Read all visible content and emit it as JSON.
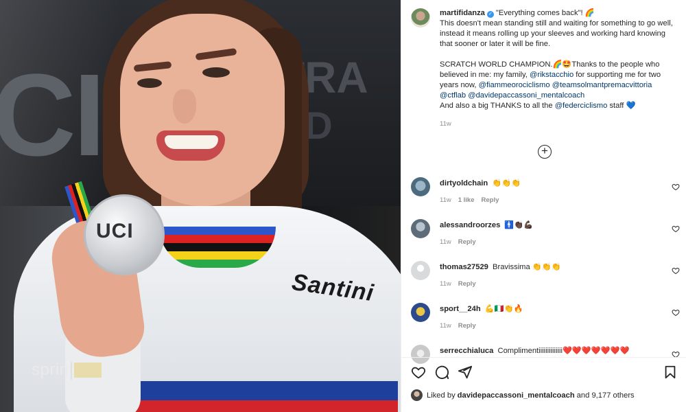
{
  "post": {
    "username": "martifidanza",
    "caption_lines": [
      "\"Everything comes back\"! 🌈",
      "This doesn't mean standing still and waiting for something to go well, instead it means rolling up your sleeves and working hard knowing that sooner or later it will be fine."
    ],
    "caption_p2_start": "SCRATCH WORLD CHAMPION.🌈🤩Thanks to the people who believed in me: my family, ",
    "mention_1": "@rikstacchio",
    "caption_p2_mid": " for supporting me for two years now, ",
    "mention_2": "@fiammeorociclismo",
    "mention_3": "@teamsolmantpremacvittoria",
    "mention_4": "@ctflab",
    "mention_5": "@davidepaccassoni_mentalcoach",
    "caption_p3_start": "And also a big THANKS to all the ",
    "mention_6": "@federciclismo",
    "caption_p3_end": " staff 💙",
    "time": "11w"
  },
  "comments": [
    {
      "user": "dirtyoldchain",
      "text": "👏👏👏",
      "time": "11w",
      "likes": "1 like",
      "reply": "Reply",
      "avatar_color": "#5a7d93"
    },
    {
      "user": "alessandroorzes",
      "text": "🚹👏🏿💪🏿",
      "time": "11w",
      "likes": "",
      "reply": "Reply",
      "avatar_color": "#6e7a86"
    },
    {
      "user": "thomas27529",
      "text": "Bravissima 👏👏👏",
      "time": "11w",
      "likes": "",
      "reply": "Reply",
      "avatar_color": "#d8dadc"
    },
    {
      "user": "sport__24h",
      "text": "💪🇮🇹👏🔥",
      "time": "11w",
      "likes": "",
      "reply": "Reply",
      "avatar_color": "#2d4b8c"
    },
    {
      "user": "serrecchialuca",
      "text": "Complimentiiiiiiiiiiiiii❤️❤️❤️❤️❤️❤️❤️",
      "time": "",
      "likes": "",
      "reply": "",
      "avatar_color": "#c9c9c9"
    }
  ],
  "liked_by": {
    "prefix": "Liked by",
    "user": "davidepaccassoni_mentalcoach",
    "suffix": "and 9,177 others"
  },
  "photo": {
    "bg_text_left": "CI",
    "bg_text_right": "TRA",
    "bg_text_right2": "LD",
    "sponsor": "Santini",
    "medal_text": "UCI",
    "watermark": "sprint"
  }
}
